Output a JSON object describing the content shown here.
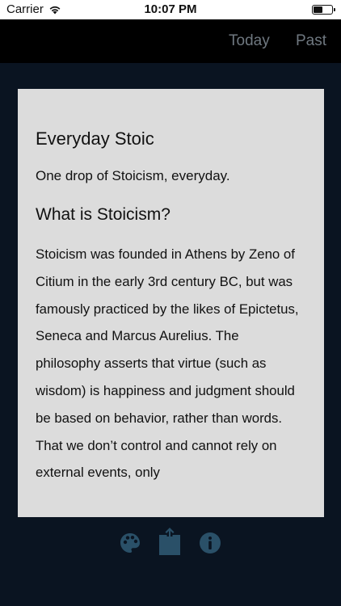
{
  "status_bar": {
    "carrier": "Carrier",
    "time": "10:07 PM"
  },
  "nav": {
    "today_label": "Today",
    "past_label": "Past"
  },
  "card": {
    "title": "Everyday Stoic",
    "subtitle": "One drop of Stoicism, everyday.",
    "section_heading": "What is Stoicism?",
    "body": "Stoicism was founded in Athens by Zeno of Citium in the early 3rd century BC, but was famously practiced by the likes of Epictetus, Seneca and Marcus Aurelius. The philosophy asserts that virtue (such as wisdom) is happiness and judgment should be based on behavior, rather than words. That we don’t control and cannot rely on external events, only"
  },
  "toolbar": {
    "icons": [
      "palette-icon",
      "share-icon",
      "info-icon"
    ],
    "icon_color": "#2a5068"
  },
  "colors": {
    "background": "#0a1421",
    "nav_background": "#000000",
    "nav_text": "#6f7880",
    "card_background": "#dcdcdc"
  }
}
